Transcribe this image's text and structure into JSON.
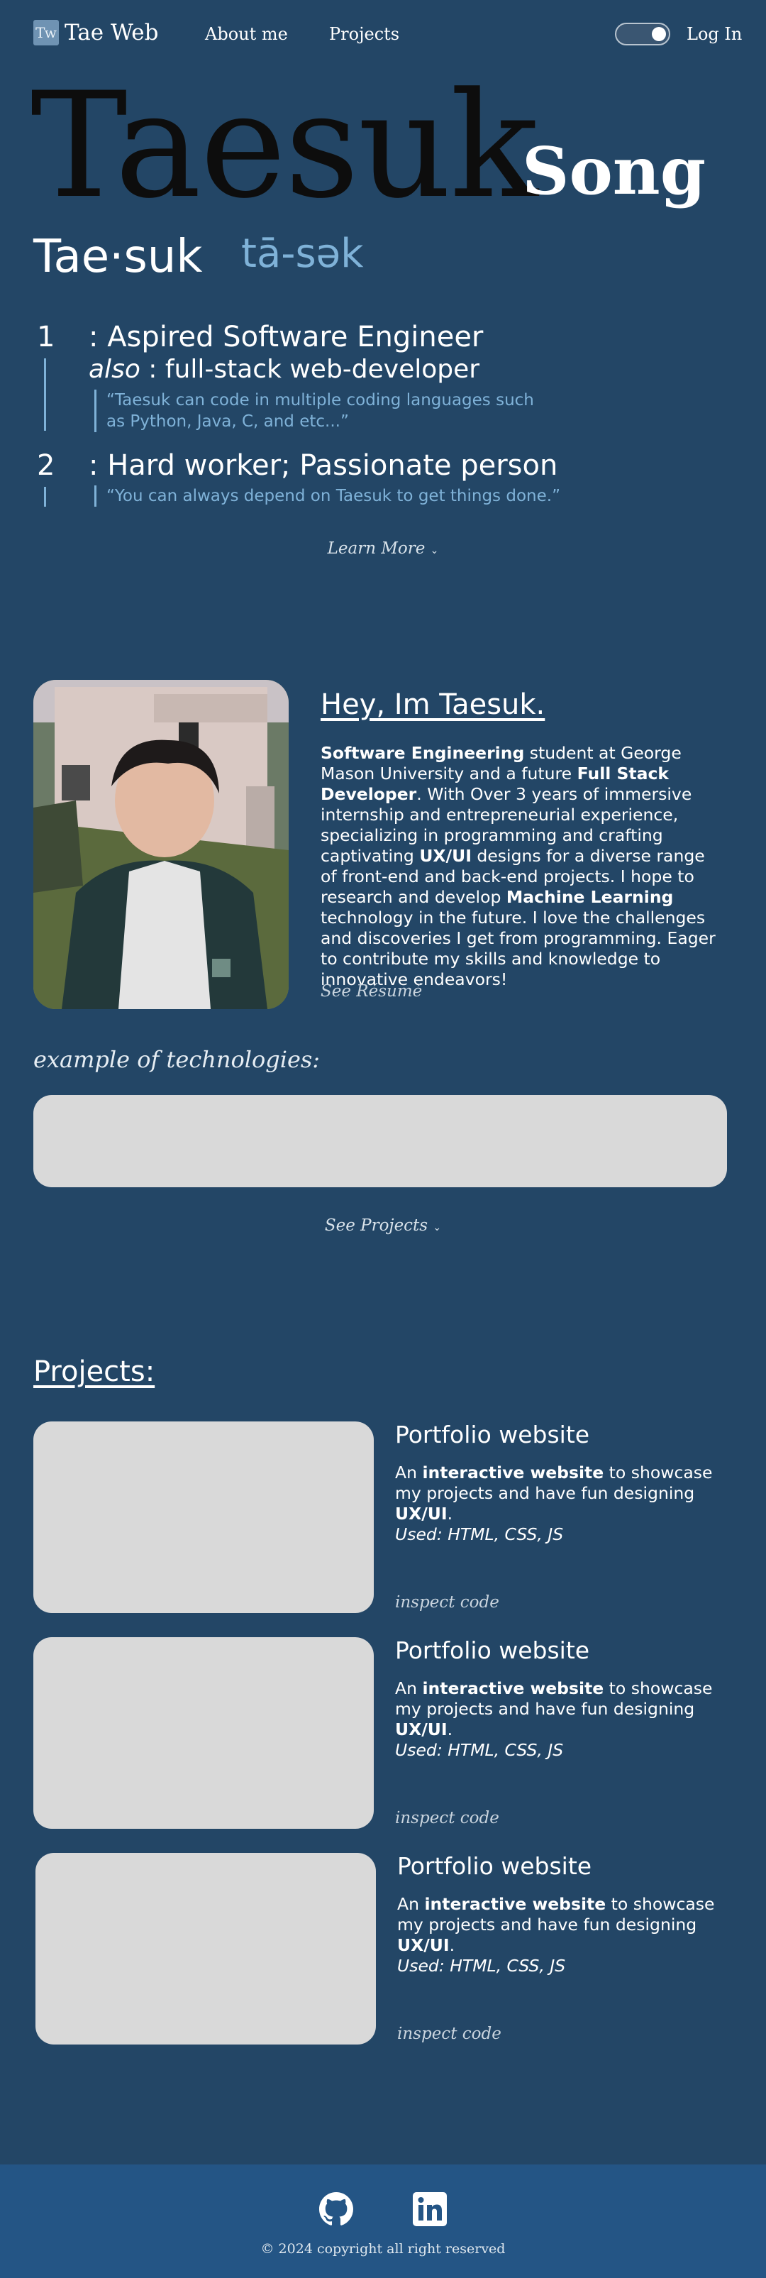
{
  "nav": {
    "logo_mark": "Tw",
    "logo_text": "Tae Web",
    "links": [
      "About me",
      "Projects"
    ],
    "login": "Log In"
  },
  "hero": {
    "first_name": "Taesuk",
    "last_name": "Song",
    "pronunciation_word": "Tae·suk",
    "pronunciation_ipa": "tā-sək",
    "definitions": [
      {
        "number": "1",
        "title": ": Aspired Software Engineer",
        "also_word": "also",
        "also_rest": " : full-stack web-developer",
        "quote": "“Taesuk can code in multiple coding languages such as Python, Java, C, and etc...”"
      },
      {
        "number": "2",
        "title": ": Hard worker; Passionate person",
        "quote": "“You can always depend on Taesuk to get things done.”"
      }
    ],
    "learn_more": "Learn More"
  },
  "about": {
    "title": "Hey, Im Taesuk.",
    "body": [
      {
        "t": "Software Engineering",
        "b": true
      },
      {
        "t": " student at George Mason University and a future ",
        "b": false
      },
      {
        "t": "Full Stack Developer",
        "b": true
      },
      {
        "t": ". With Over 3 years of immersive internship and entrepreneurial experience, specializing in programming and crafting captivating ",
        "b": false
      },
      {
        "t": "UX/UI",
        "b": true
      },
      {
        "t": " designs for a diverse range of front-end and back-end projects. I hope to research and develop ",
        "b": false
      },
      {
        "t": "Machine Learning",
        "b": true
      },
      {
        "t": " technology in the future. I love the challenges and discoveries I get from programming. Eager to contribute my skills and knowledge to innovative endeavors!",
        "b": false
      }
    ],
    "see_resume": "See Résumé",
    "tech_title": "example of  technologies:",
    "see_projects": "See Projects"
  },
  "projects": {
    "title": "Projects:",
    "items": [
      {
        "name": "Portfolio website",
        "pre": "An ",
        "bold1": "interactive website",
        "mid": " to showcase my projects and have fun designing ",
        "bold2": "UX/UI",
        "post": ".",
        "used": "Used: HTML, CSS, JS",
        "inspect": "inspect code"
      },
      {
        "name": "Portfolio website",
        "pre": "An ",
        "bold1": "interactive website",
        "mid": " to showcase my projects and have fun designing ",
        "bold2": "UX/UI",
        "post": ".",
        "used": "Used: HTML, CSS, JS",
        "inspect": "inspect code"
      },
      {
        "name": "Portfolio website",
        "pre": "An ",
        "bold1": "interactive website",
        "mid": " to showcase my projects and have fun designing ",
        "bold2": "UX/UI",
        "post": ".",
        "used": "Used: HTML, CSS, JS",
        "inspect": "inspect code"
      }
    ]
  },
  "footer": {
    "copyright": "© 2024 copyright all right reserved",
    "icons": [
      "github-icon",
      "linkedin-icon"
    ]
  },
  "colors": {
    "background": "#234666",
    "footer": "#245585",
    "accent": "#7fb2d8",
    "placeholder": "#d9d9d9"
  }
}
